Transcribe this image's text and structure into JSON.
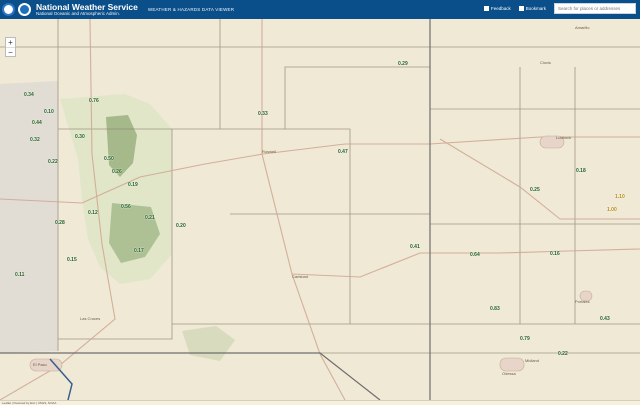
{
  "header": {
    "title": "National Weather Service",
    "subtitle": "National Oceanic and Atmospheric Admin.",
    "viewer_title": "WEATHER & HAZARDS DATA VIEWER",
    "feedback_label": "Feedback",
    "bookmark_label": "Bookmark",
    "search_placeholder": "Search for places or addresses"
  },
  "zoom": {
    "in_label": "+",
    "out_label": "−"
  },
  "map": {
    "city_labels": [
      "Roswell",
      "Lubbock",
      "Carlsbad",
      "Midland",
      "Odessa",
      "Clovis",
      "Portales",
      "Amarillo",
      "Las Cruces",
      "El Paso"
    ],
    "markers": [
      {
        "text": "0.34",
        "color": "green"
      },
      {
        "text": "0.76",
        "color": "green"
      },
      {
        "text": "0.10",
        "color": "green"
      },
      {
        "text": "0.44",
        "color": "green"
      },
      {
        "text": "0.32",
        "color": "green"
      },
      {
        "text": "0.30",
        "color": "green"
      },
      {
        "text": "0.22",
        "color": "green"
      },
      {
        "text": "0.50",
        "color": "green"
      },
      {
        "text": "0.26",
        "color": "green"
      },
      {
        "text": "0.19",
        "color": "green"
      },
      {
        "text": "0.12",
        "color": "green"
      },
      {
        "text": "0.28",
        "color": "green"
      },
      {
        "text": "0.56",
        "color": "green"
      },
      {
        "text": "0.21",
        "color": "green"
      },
      {
        "text": "0.20",
        "color": "green"
      },
      {
        "text": "0.17",
        "color": "green"
      },
      {
        "text": "0.15",
        "color": "green"
      },
      {
        "text": "0.11",
        "color": "green"
      },
      {
        "text": "0.33",
        "color": "green"
      },
      {
        "text": "0.29",
        "color": "green"
      },
      {
        "text": "0.47",
        "color": "green"
      },
      {
        "text": "0.41",
        "color": "green"
      },
      {
        "text": "0.64",
        "color": "green"
      },
      {
        "text": "0.83",
        "color": "green"
      },
      {
        "text": "0.25",
        "color": "green"
      },
      {
        "text": "0.16",
        "color": "green"
      },
      {
        "text": "0.79",
        "color": "green"
      },
      {
        "text": "0.22",
        "color": "green"
      },
      {
        "text": "0.43",
        "color": "green"
      },
      {
        "text": "0.18",
        "color": "green"
      },
      {
        "text": "1.00",
        "color": "gold"
      },
      {
        "text": "1.10",
        "color": "gold"
      }
    ]
  },
  "footer": {
    "attribution": "Leaflet | Powered by Esri | USGS, NOAA"
  }
}
